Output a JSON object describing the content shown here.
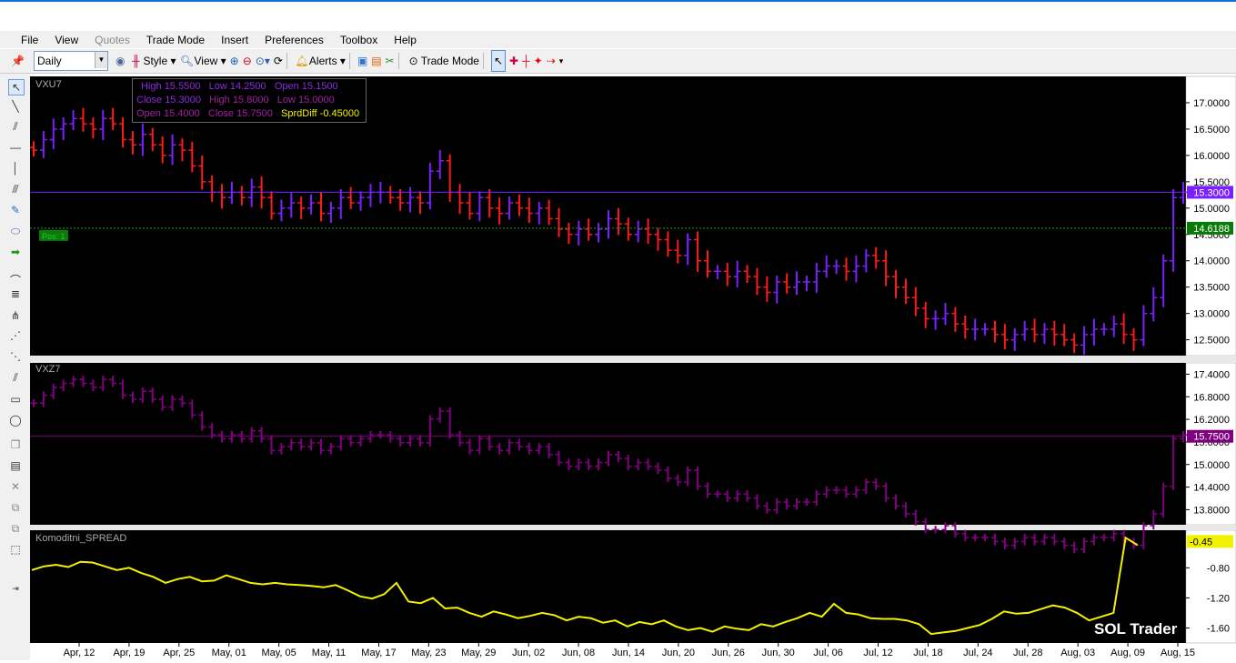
{
  "menu": [
    "File",
    "View",
    "Quotes",
    "Trade Mode",
    "Insert",
    "Preferences",
    "Toolbox",
    "Help"
  ],
  "menu_disabled": [
    "Quotes"
  ],
  "toolbar": {
    "period": "Daily",
    "style_label": "Style",
    "view_label": "View",
    "alerts_label": "Alerts",
    "trade_mode_label": "Trade Mode"
  },
  "info_box": {
    "row1": [
      "High",
      "15.5500",
      "Low",
      "14.2500",
      "Open",
      "15.1500"
    ],
    "row2": [
      "Close",
      "15.3000",
      "High",
      "15.8000",
      "Low",
      "15.0000"
    ],
    "row3": [
      "Open",
      "15.4000",
      "Close",
      "15.7500",
      "SprdDiff",
      "-0.45000"
    ]
  },
  "colors": {
    "up": "#7a20ff",
    "down": "#ff1a1a",
    "vxz": "#800080",
    "spread": "#f2f200",
    "pos_green": "#0a7a0a"
  },
  "chart_data": [
    {
      "type": "ohlc",
      "title": "VXU7",
      "ylim": [
        12.2,
        17.5
      ],
      "y_ticks": [
        "17.0000",
        "16.5000",
        "16.0000",
        "15.5000",
        "15.0000",
        "14.5000",
        "14.0000",
        "13.5000",
        "13.0000",
        "12.5000"
      ],
      "last_value_label": "15.3000",
      "position_label": "Pos: 1",
      "position_value_label": "14.6188",
      "position_value": 14.6188,
      "closes": [
        16.1,
        16.3,
        16.5,
        16.6,
        16.7,
        16.6,
        16.5,
        16.7,
        16.6,
        16.3,
        16.2,
        16.4,
        16.2,
        16.0,
        16.2,
        16.1,
        15.8,
        15.5,
        15.3,
        15.2,
        15.3,
        15.2,
        15.4,
        15.2,
        14.9,
        15.0,
        15.1,
        15.0,
        15.1,
        14.9,
        15.0,
        15.2,
        15.1,
        15.2,
        15.3,
        15.3,
        15.2,
        15.1,
        15.2,
        15.1,
        15.7,
        15.9,
        15.3,
        15.1,
        14.9,
        15.2,
        15.0,
        14.9,
        15.1,
        15.0,
        14.9,
        15.0,
        14.8,
        14.6,
        14.5,
        14.6,
        14.5,
        14.6,
        14.8,
        14.7,
        14.5,
        14.6,
        14.5,
        14.4,
        14.2,
        14.1,
        14.4,
        14.0,
        13.8,
        13.8,
        13.7,
        13.8,
        13.7,
        13.5,
        13.4,
        13.6,
        13.5,
        13.6,
        13.6,
        13.8,
        13.9,
        13.9,
        13.8,
        13.9,
        14.1,
        14.0,
        13.7,
        13.5,
        13.3,
        13.1,
        12.9,
        12.9,
        13.0,
        12.8,
        12.7,
        12.7,
        12.7,
        12.6,
        12.5,
        12.6,
        12.7,
        12.6,
        12.7,
        12.6,
        12.5,
        12.4,
        12.6,
        12.7,
        12.7,
        12.8,
        12.6,
        12.5,
        13.0,
        13.3,
        14.0,
        15.2,
        15.3
      ],
      "x_labels": [
        "Apr, 12",
        "Apr, 19",
        "Apr, 25",
        "May, 01",
        "May, 05",
        "May, 11",
        "May, 17",
        "May, 23",
        "May, 29",
        "Jun, 02",
        "Jun, 08",
        "Jun, 14",
        "Jun, 20",
        "Jun, 26",
        "Jun, 30",
        "Jul, 06",
        "Jul, 12",
        "Jul, 18",
        "Jul, 24",
        "Jul, 28",
        "Aug, 03",
        "Aug, 09",
        "Aug, 15"
      ]
    },
    {
      "type": "ohlc",
      "title": "VXZ7",
      "ylim": [
        13.4,
        17.7
      ],
      "y_ticks": [
        "17.4000",
        "16.8000",
        "16.2000",
        "15.6000",
        "15.0000",
        "14.4000",
        "13.8000"
      ],
      "last_value_label": "15.7500"
    },
    {
      "type": "line",
      "title": "Komoditni_SPREAD",
      "ylim": [
        -1.8,
        -0.3
      ],
      "y_ticks": [
        "-0.80",
        "-1.20",
        "-1.60"
      ],
      "last_value_label": "-0.45",
      "values": [
        -0.83,
        -0.78,
        -0.76,
        -0.79,
        -0.72,
        -0.73,
        -0.78,
        -0.83,
        -0.8,
        -0.87,
        -0.92,
        -1.0,
        -0.95,
        -0.92,
        -0.98,
        -0.97,
        -0.9,
        -0.95,
        -1.0,
        -1.02,
        -1.0,
        -1.02,
        -1.03,
        -1.04,
        -1.06,
        -1.03,
        -1.1,
        -1.18,
        -1.21,
        -1.15,
        -1.0,
        -1.25,
        -1.27,
        -1.2,
        -1.34,
        -1.33,
        -1.4,
        -1.45,
        -1.38,
        -1.42,
        -1.47,
        -1.44,
        -1.4,
        -1.43,
        -1.5,
        -1.45,
        -1.47,
        -1.53,
        -1.5,
        -1.58,
        -1.52,
        -1.55,
        -1.5,
        -1.58,
        -1.63,
        -1.6,
        -1.65,
        -1.58,
        -1.61,
        -1.63,
        -1.55,
        -1.58,
        -1.52,
        -1.47,
        -1.4,
        -1.45,
        -1.28,
        -1.4,
        -1.42,
        -1.47,
        -1.48,
        -1.48,
        -1.5,
        -1.55,
        -1.68,
        -1.66,
        -1.64,
        -1.6,
        -1.56,
        -1.48,
        -1.38,
        -1.41,
        -1.4,
        -1.35,
        -1.3,
        -1.33,
        -1.4,
        -1.5,
        -1.45,
        -1.4,
        -0.4,
        -0.5
      ]
    }
  ],
  "brand": "SOL Trader"
}
